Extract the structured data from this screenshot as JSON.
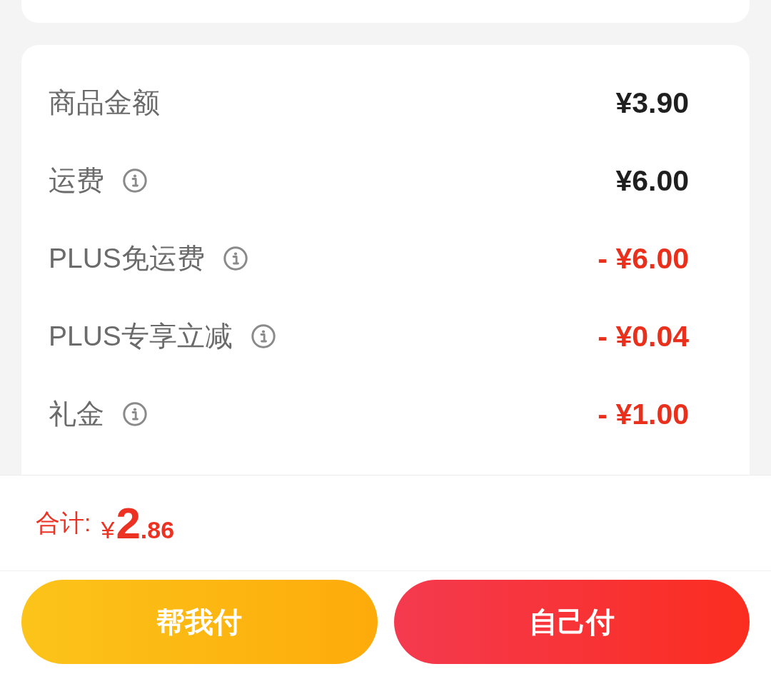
{
  "summary_rows": [
    {
      "label": "商品金额",
      "info": false,
      "kind": "charge",
      "value": "¥3.90"
    },
    {
      "label": "运费",
      "info": true,
      "kind": "charge",
      "value": "¥6.00"
    },
    {
      "label": "PLUS免运费",
      "info": true,
      "kind": "discount",
      "value": "- ¥6.00"
    },
    {
      "label": "PLUS专享立减",
      "info": true,
      "kind": "discount",
      "value": "- ¥0.04"
    },
    {
      "label": "礼金",
      "info": true,
      "kind": "discount",
      "value": "- ¥1.00"
    }
  ],
  "total": {
    "label": "合计:",
    "currency": "¥",
    "integer": "2",
    "fraction": ".86"
  },
  "buttons": [
    {
      "label": "帮我付",
      "kind": "assist"
    },
    {
      "label": "自己付",
      "kind": "primary"
    }
  ]
}
